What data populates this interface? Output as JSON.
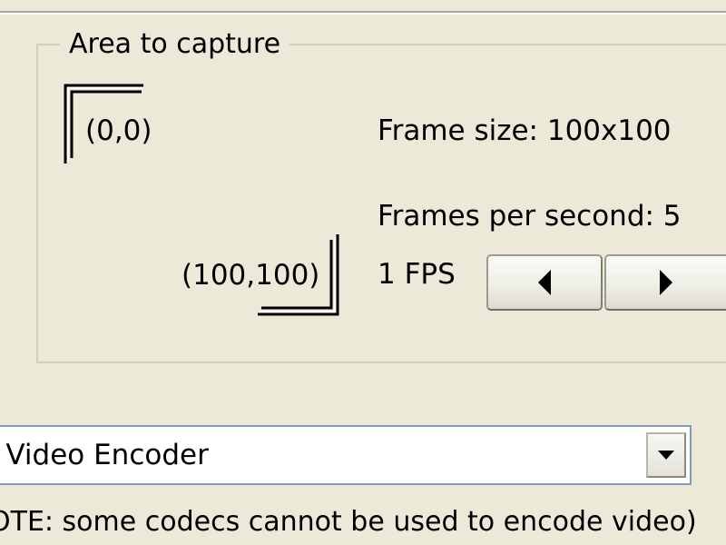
{
  "capture_group": {
    "title": "Area to capture",
    "top_left_label": "(0,0)",
    "bottom_right_label": "(100,100)",
    "frame_size_text": "Frame size: 100x100",
    "fps_text": "Frames per second: 5",
    "fps_min_text": "1 FPS"
  },
  "fps_controls": {
    "decrease_icon": "left-arrow-icon",
    "increase_icon": "right-arrow-icon"
  },
  "codec": {
    "selected": "' Video Encoder",
    "dropdown_icon": "chevron-down-icon"
  },
  "note": "OTE: some codecs cannot be used to encode video)"
}
